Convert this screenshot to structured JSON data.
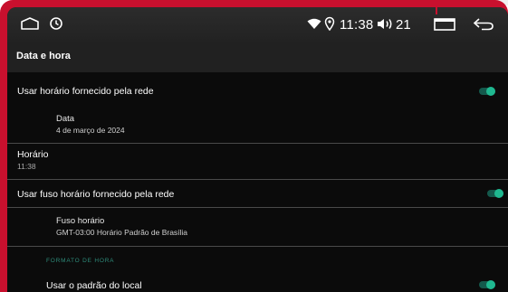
{
  "statusbar": {
    "time": "11:38",
    "volume": "21",
    "icons": [
      "home-icon",
      "clock-icon",
      "wifi-icon",
      "location-icon",
      "volume-icon",
      "recent-apps-icon",
      "back-icon"
    ]
  },
  "header": {
    "title": "Data e hora"
  },
  "settings": {
    "network_time_label": "Usar horário fornecido pela rede",
    "network_time_on": true,
    "date_label": "Data",
    "date_value": "4 de março de 2024",
    "time_label": "Horário",
    "time_value": "11:38",
    "network_timezone_label": "Usar fuso horário fornecido pela rede",
    "network_timezone_on": true,
    "timezone_label": "Fuso horário",
    "timezone_value": "GMT-03:00 Horário Padrão de Brasília",
    "time_format_section": "FORMATO DE HORA",
    "locale_default_label": "Usar o padrão do local",
    "locale_default_on": true
  },
  "colors": {
    "frame": "#c8102e",
    "accent": "#1fb890",
    "background": "#0b0b0b"
  }
}
